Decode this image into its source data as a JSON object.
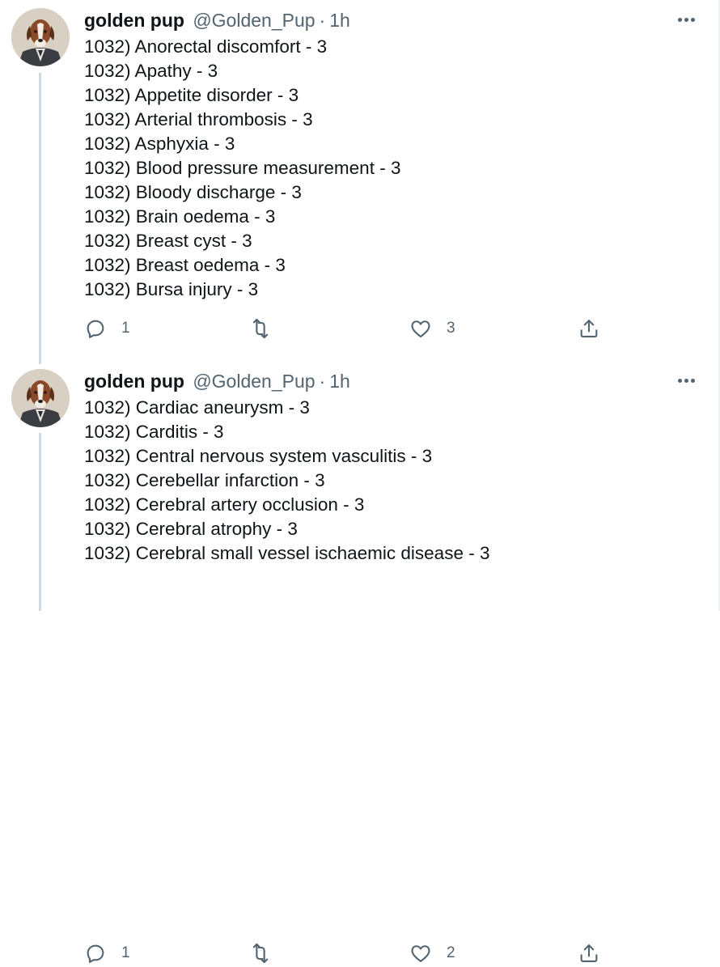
{
  "tweets": [
    {
      "display_name": "golden pup",
      "handle": "@Golden_Pup",
      "separator": "·",
      "time": "1h",
      "lines": [
        "1032) Anorectal discomfort - 3",
        "1032) Apathy - 3",
        "1032) Appetite disorder - 3",
        "1032) Arterial thrombosis - 3",
        "1032) Asphyxia - 3",
        "1032) Blood pressure measurement - 3",
        "1032) Bloody discharge - 3",
        "1032) Brain oedema - 3",
        "1032) Breast cyst - 3",
        "1032) Breast oedema - 3",
        "1032) Bursa injury - 3"
      ],
      "reply_count": "1",
      "retweet_count": "",
      "like_count": "3"
    },
    {
      "display_name": "golden pup",
      "handle": "@Golden_Pup",
      "separator": "·",
      "time": "1h",
      "lines": [
        "1032) Cardiac aneurysm - 3",
        "1032) Carditis - 3",
        "1032) Central nervous system vasculitis - 3",
        "1032) Cerebellar infarction - 3",
        "1032) Cerebral artery occlusion - 3",
        "1032) Cerebral atrophy - 3",
        "1032) Cerebral small vessel ischaemic disease - 3"
      ],
      "reply_count": "1",
      "retweet_count": "",
      "like_count": "2"
    }
  ],
  "icons": {
    "avatar": "dog-portrait-avatar",
    "more": "more-options-icon",
    "reply": "reply-icon",
    "retweet": "retweet-icon",
    "like": "heart-icon",
    "share": "share-icon"
  },
  "colors": {
    "text": "#0f1419",
    "secondary": "#536471",
    "thread_line": "#cfd9de"
  }
}
